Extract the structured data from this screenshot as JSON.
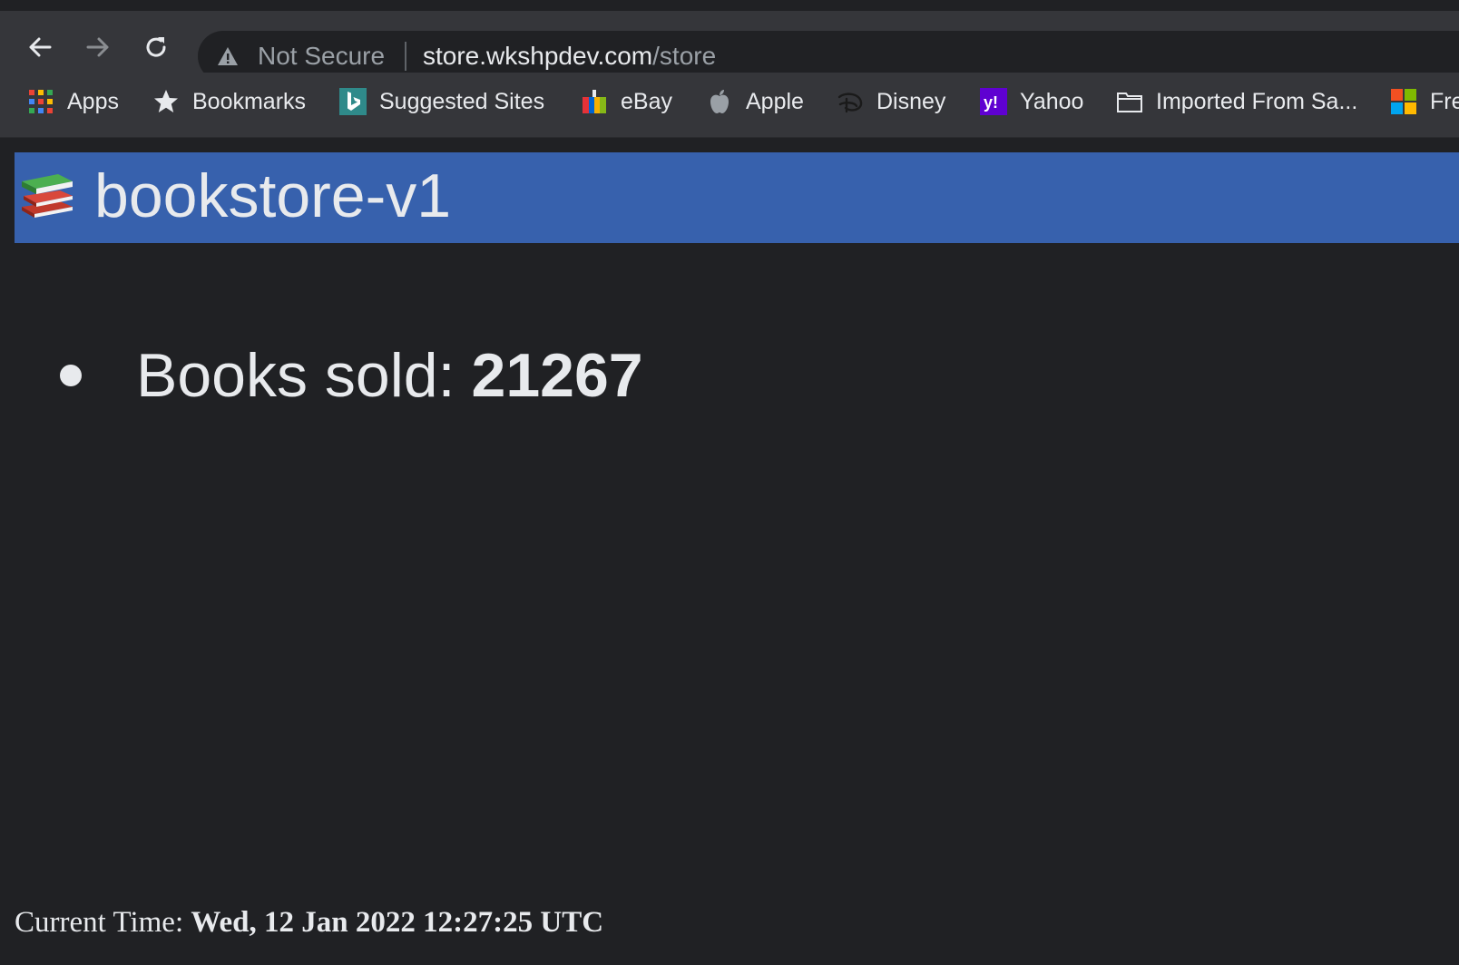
{
  "browser": {
    "omnibox": {
      "security_label": "Not Secure",
      "host": "store.wkshpdev.com",
      "path": "/store"
    },
    "bookmarks": [
      {
        "label": "Apps",
        "icon": "apps-grid-icon"
      },
      {
        "label": "Bookmarks",
        "icon": "star-icon"
      },
      {
        "label": "Suggested Sites",
        "icon": "bing-icon"
      },
      {
        "label": "eBay",
        "icon": "ebay-icon"
      },
      {
        "label": "Apple",
        "icon": "apple-icon"
      },
      {
        "label": "Disney",
        "icon": "disney-icon"
      },
      {
        "label": "Yahoo",
        "icon": "yahoo-icon"
      },
      {
        "label": "Imported From Sa...",
        "icon": "folder-icon"
      },
      {
        "label": "Fre",
        "icon": "microsoft-icon"
      }
    ]
  },
  "page": {
    "banner_title": "bookstore-v1",
    "stat_label": "Books sold:",
    "stat_value": "21267",
    "footer_label": "Current Time:",
    "footer_value": "Wed, 12 Jan 2022 12:27:25 UTC"
  },
  "colors": {
    "banner": "#3761ad",
    "page_background": "#202124",
    "chrome": "#35363a"
  }
}
